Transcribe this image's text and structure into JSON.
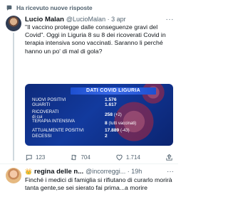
{
  "notice": {
    "text": "Ha ricevuto nuove risposte"
  },
  "tweet": {
    "author_name": "Lucio Malan",
    "handle_time": "@LucioMalan · 3 apr",
    "text": "\"Il vaccino protegge dalle conseguenze gravi del Covid\". Oggi in Liguria 8 su 8 dei ricoverati Covid in terapia intensiva sono vaccinati. Saranno li perché hanno un po' di mal di gola?",
    "media": {
      "title": "DATI COVID LIGURIA",
      "rows": [
        {
          "label": "NUOVI POSITIVI",
          "value": "1.576",
          "delta": ""
        },
        {
          "label": "GUARITI",
          "value": "1.617",
          "delta": ""
        },
        {
          "label": "RICOVERATI\ndi cui\nTERAPIA INTENSIVA",
          "value": "258",
          "delta": "(+2)"
        },
        {
          "label": "",
          "value": "8",
          "delta": "(tutti vaccinati)"
        },
        {
          "label": "ATTUALMENTE POSITIVI",
          "value": "17.889",
          "delta": "(-43)"
        },
        {
          "label": "DECESSI",
          "value": "2",
          "delta": ""
        }
      ]
    },
    "actions": {
      "replies": "123",
      "retweets": "704",
      "likes": "1.714"
    }
  },
  "reply": {
    "emoji": "👑",
    "author_name": "regina delle n...",
    "handle_time": "@incorreggi... · 19h",
    "text": "Finché i medici di famiglia si rifiutano di curarlo morirà tanta gente,se sei sierato fai prima...a morire"
  },
  "colors": {
    "accent": "#1d9bf0",
    "muted": "#536471",
    "media_bg": "#123a9e"
  }
}
